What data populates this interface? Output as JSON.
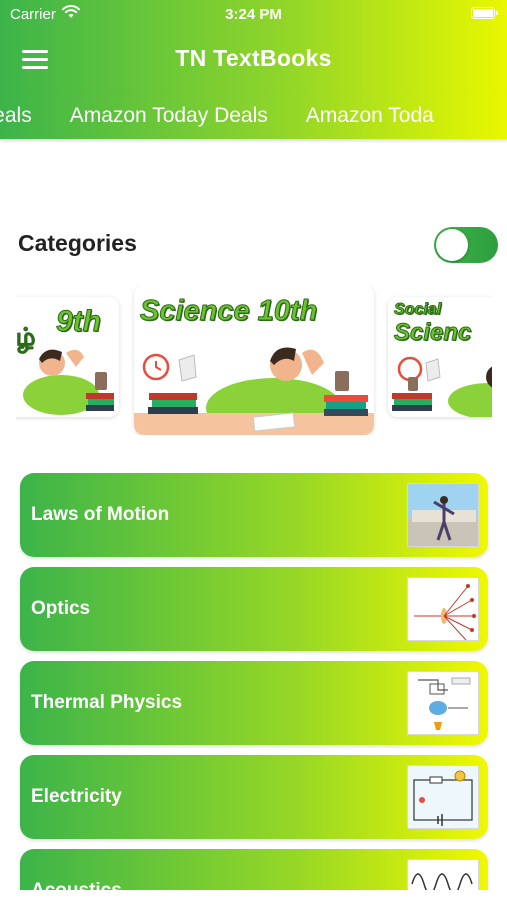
{
  "status_bar": {
    "carrier": "Carrier",
    "time": "3:24 PM"
  },
  "header": {
    "title": "TN TextBooks",
    "menu_icon": "hamburger-menu-icon"
  },
  "marquee": {
    "items": [
      "Deals",
      "Amazon Today Deals",
      "Amazon Toda"
    ]
  },
  "categories": {
    "title": "Categories",
    "toggle_on": true
  },
  "carousel": {
    "banners": [
      {
        "name": "banner-9th",
        "title": "9th"
      },
      {
        "name": "banner-science-10th",
        "title": "Science 10th"
      },
      {
        "name": "banner-social-science",
        "title_top": "Social",
        "title_bottom": "Scienc"
      }
    ]
  },
  "topics": [
    {
      "label": "Laws of Motion",
      "thumb": "dancer-photo-icon"
    },
    {
      "label": "Optics",
      "thumb": "light-rays-diagram-icon"
    },
    {
      "label": "Thermal Physics",
      "thumb": "heat-apparatus-diagram-icon"
    },
    {
      "label": "Electricity",
      "thumb": "circuit-diagram-icon"
    },
    {
      "label": "Acoustics",
      "thumb": "waveform-icon"
    }
  ],
  "colors": {
    "gradient_start": "#3cb44a",
    "gradient_end": "#e9f700",
    "toggle": "#3cb44a"
  }
}
